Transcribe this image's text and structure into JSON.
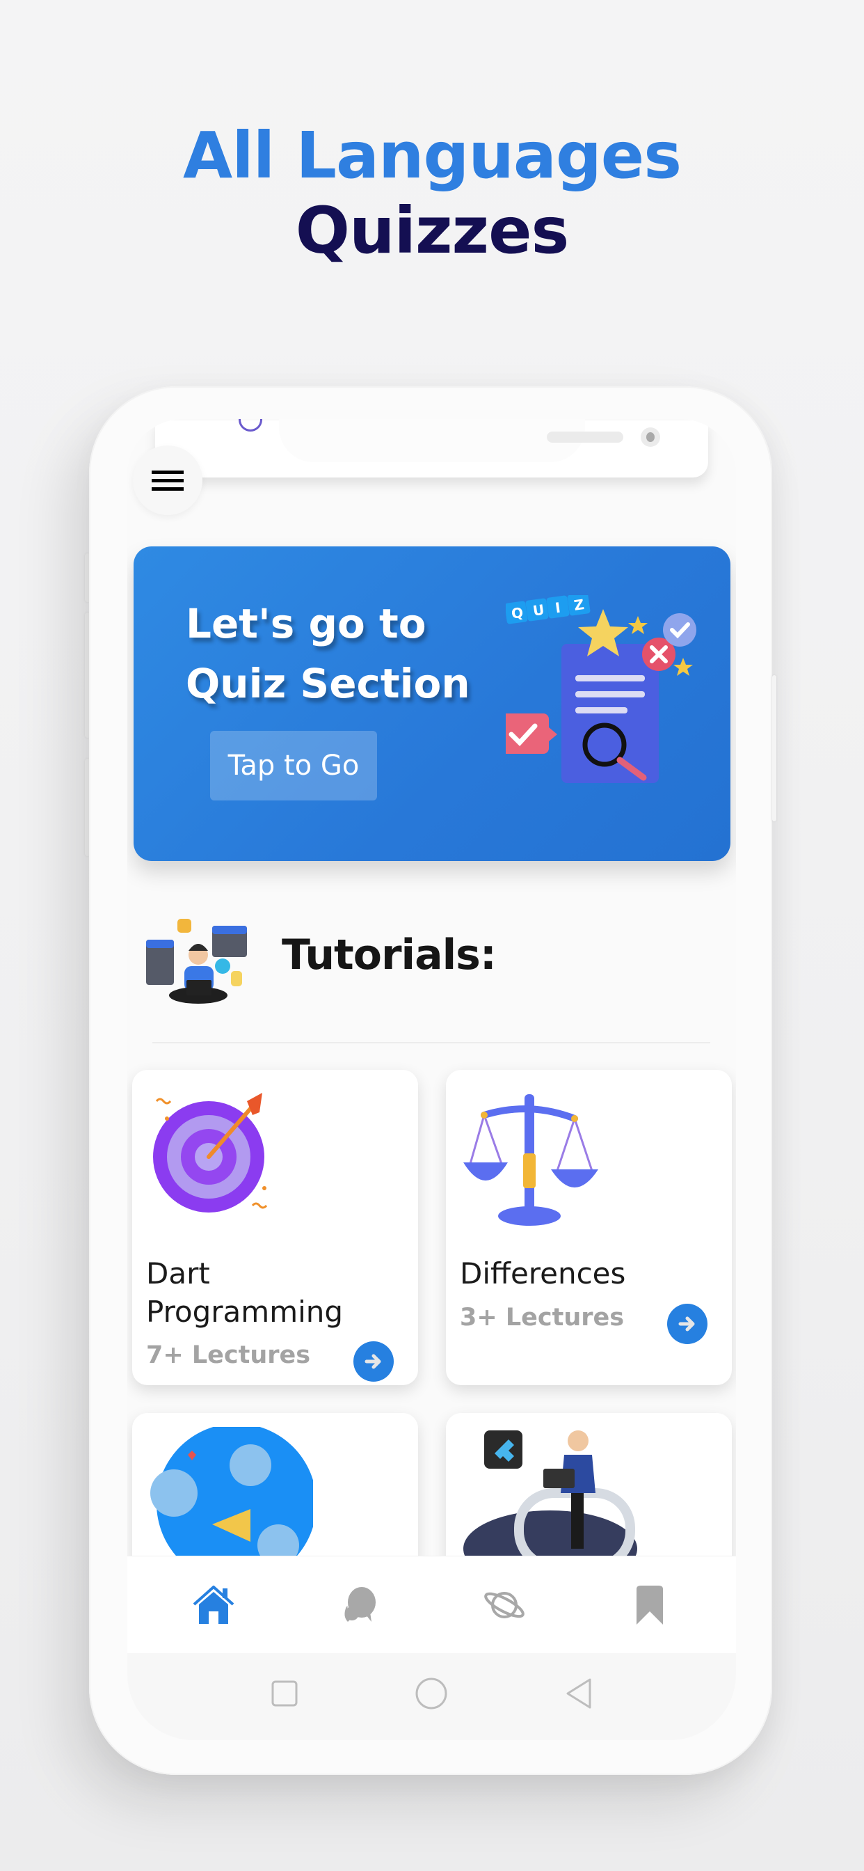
{
  "promo": {
    "headline_line1": "All Languages",
    "headline_line2": "Quizzes",
    "colors": {
      "line1": "#2f7fe0",
      "line2": "#140f52"
    }
  },
  "app": {
    "menu_icon": "hamburger-menu-icon",
    "banner": {
      "title_line1": "Let's go to",
      "title_line2": "Quiz Section",
      "button_label": "Tap to Go",
      "illustration": "quiz-clipboard-illustration",
      "color": "#2b80de"
    },
    "tutorials": {
      "heading": "Tutorials:",
      "illustration": "developer-laptop-illustration",
      "cards": [
        {
          "title": "Dart Programming",
          "title_line1": "Dart",
          "title_line2": "Programming",
          "subtitle": "7+ Lectures",
          "illustration": "target-arrow-illustration"
        },
        {
          "title": "Differences",
          "subtitle": "3+ Lectures",
          "illustration": "balance-scale-illustration"
        },
        {
          "title": "",
          "subtitle": "",
          "illustration": "birds-megaphone-illustration"
        },
        {
          "title": "",
          "subtitle": "",
          "illustration": "flutter-developer-illustration"
        }
      ]
    },
    "bottom_nav": {
      "items": [
        {
          "name": "home",
          "icon": "home-icon",
          "active": true
        },
        {
          "name": "chat",
          "icon": "chat-bubbles-icon",
          "active": false
        },
        {
          "name": "explore",
          "icon": "planet-icon",
          "active": false
        },
        {
          "name": "bookmarks",
          "icon": "bookmark-icon",
          "active": false
        }
      ],
      "active_color": "#2680e0",
      "inactive_color": "#a8a8a8"
    },
    "system_nav": {
      "items": [
        "recents-square-icon",
        "home-circle-icon",
        "back-triangle-icon"
      ]
    }
  }
}
